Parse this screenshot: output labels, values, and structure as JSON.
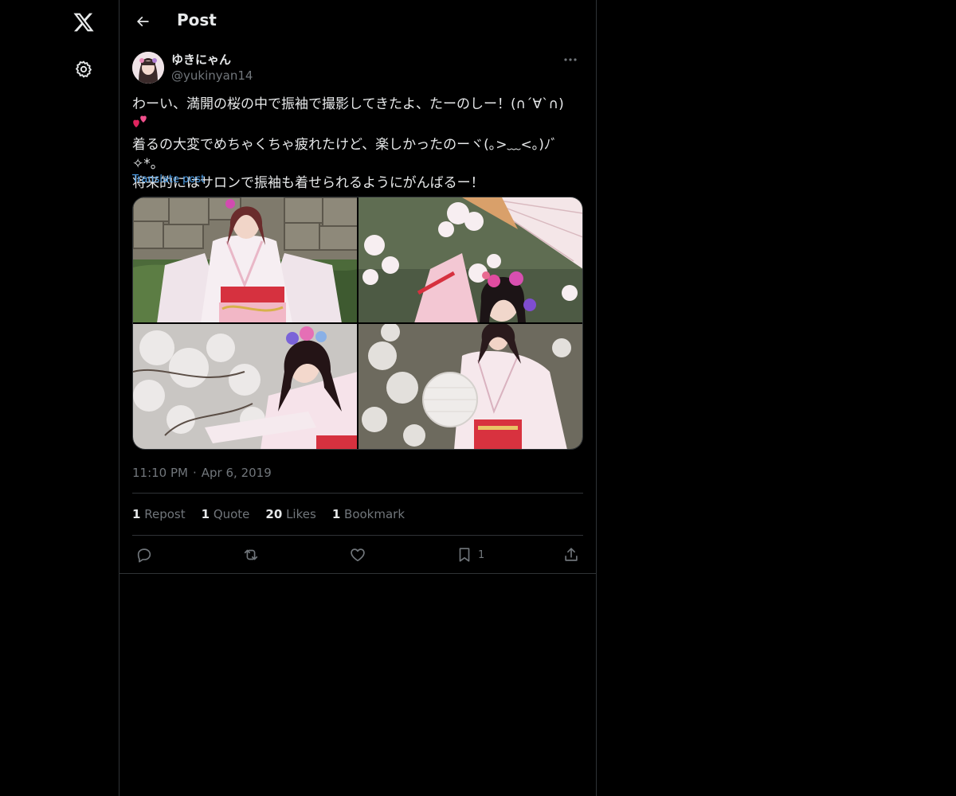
{
  "header": {
    "title": "Post"
  },
  "post": {
    "author": {
      "display_name": "ゆきにゃん",
      "handle": "@yukinyan14"
    },
    "text_line1": "わーい、満開の桜の中で振袖で撮影してきたよ、たーのしー！(∩´∀`∩)",
    "text_line3": "着るの大変でめちゃくちゃ疲れたけど、楽しかったのーヾ(｡>﹏<｡)ﾉﾞ✧*。",
    "text_line4": "将来的にはサロンで振袖も着せられるようにがんばるー！",
    "translate_label": "Translate post",
    "time": "11:10 PM",
    "date": "Apr 6, 2019",
    "timestamp_separator": "·"
  },
  "stats": {
    "reposts_count": "1",
    "reposts_label": "Repost",
    "quotes_count": "1",
    "quotes_label": "Quote",
    "likes_count": "20",
    "likes_label": "Likes",
    "bookmarks_count": "1",
    "bookmarks_label": "Bookmark"
  },
  "actions": {
    "bookmark_count": "1"
  },
  "icons": {
    "logo": "x-logo-icon",
    "settings": "gear-icon",
    "back": "arrow-left-icon",
    "more": "more-horizontal-icon",
    "reply": "reply-icon",
    "repost": "repost-icon",
    "like": "heart-icon",
    "bookmark": "bookmark-icon",
    "share": "share-icon"
  },
  "colors": {
    "background": "#000000",
    "text_primary": "#e7e9ea",
    "text_secondary": "#71767b",
    "link": "#4e9fe8",
    "border": "#2f3336"
  }
}
